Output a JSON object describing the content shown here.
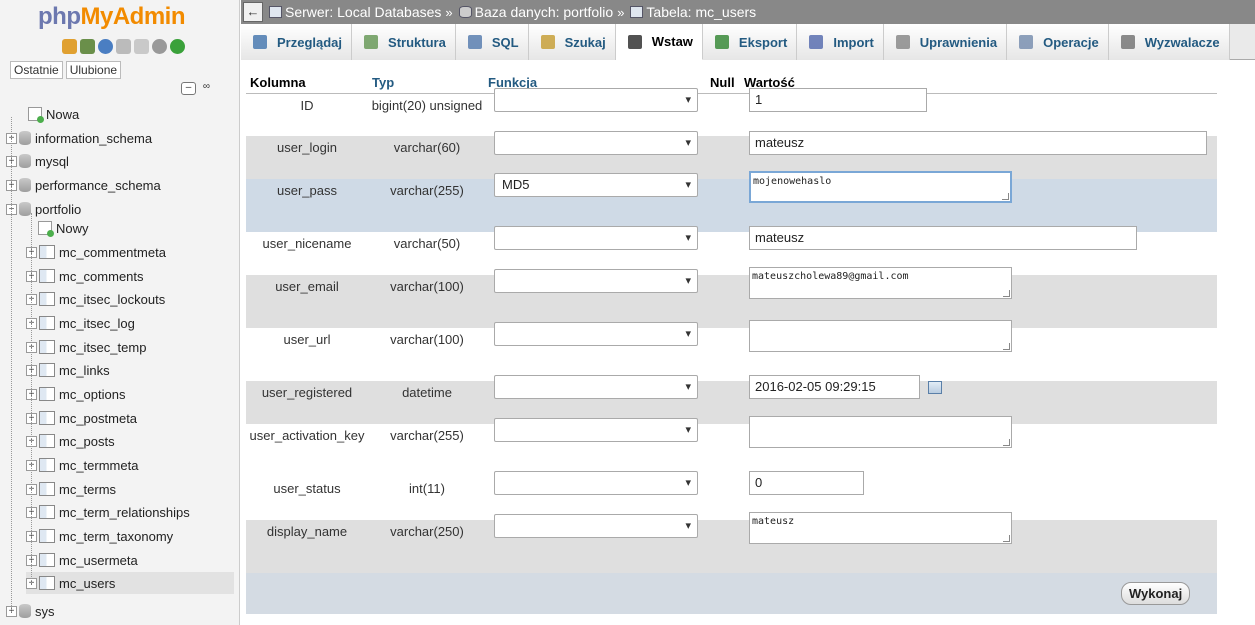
{
  "logo": {
    "part1": "php",
    "part2": "MyAdmin"
  },
  "sidebar": {
    "recent_tabs": [
      "Ostatnie",
      "Ulubione"
    ],
    "tree": [
      {
        "label": "Nowa",
        "kind": "new"
      },
      {
        "label": "information_schema",
        "kind": "db"
      },
      {
        "label": "mysql",
        "kind": "db"
      },
      {
        "label": "performance_schema",
        "kind": "db"
      },
      {
        "label": "portfolio",
        "kind": "db-open"
      },
      {
        "label": "Nowy",
        "kind": "new-table"
      },
      {
        "label": "mc_commentmeta",
        "kind": "table"
      },
      {
        "label": "mc_comments",
        "kind": "table"
      },
      {
        "label": "mc_itsec_lockouts",
        "kind": "table"
      },
      {
        "label": "mc_itsec_log",
        "kind": "table"
      },
      {
        "label": "mc_itsec_temp",
        "kind": "table"
      },
      {
        "label": "mc_links",
        "kind": "table"
      },
      {
        "label": "mc_options",
        "kind": "table"
      },
      {
        "label": "mc_postmeta",
        "kind": "table"
      },
      {
        "label": "mc_posts",
        "kind": "table"
      },
      {
        "label": "mc_termmeta",
        "kind": "table"
      },
      {
        "label": "mc_terms",
        "kind": "table"
      },
      {
        "label": "mc_term_relationships",
        "kind": "table"
      },
      {
        "label": "mc_term_taxonomy",
        "kind": "table"
      },
      {
        "label": "mc_usermeta",
        "kind": "table"
      },
      {
        "label": "mc_users",
        "kind": "table-selected"
      },
      {
        "label": "sys",
        "kind": "db"
      }
    ]
  },
  "breadcrumb": {
    "server": "Serwer: Local Databases",
    "database": "Baza danych: portfolio",
    "table": "Tabela: mc_users",
    "sep": "»"
  },
  "tabs": [
    {
      "label": "Przeglądaj",
      "icon": "browse-icon"
    },
    {
      "label": "Struktura",
      "icon": "structure-icon"
    },
    {
      "label": "SQL",
      "icon": "sql-icon"
    },
    {
      "label": "Szukaj",
      "icon": "search-icon"
    },
    {
      "label": "Wstaw",
      "icon": "insert-icon",
      "active": true
    },
    {
      "label": "Eksport",
      "icon": "export-icon"
    },
    {
      "label": "Import",
      "icon": "import-icon"
    },
    {
      "label": "Uprawnienia",
      "icon": "privileges-icon"
    },
    {
      "label": "Operacje",
      "icon": "wrench-icon"
    },
    {
      "label": "Wyzwalacze",
      "icon": "triggers-icon"
    }
  ],
  "form": {
    "headers": {
      "column": "Kolumna",
      "type": "Typ",
      "function": "Funkcja",
      "null": "Null",
      "value": "Wartość"
    },
    "rows": [
      {
        "column": "ID",
        "type": "bigint(20) unsigned",
        "function": "",
        "value": "1",
        "widget": "input"
      },
      {
        "column": "user_login",
        "type": "varchar(60)",
        "function": "",
        "value": "mateusz",
        "widget": "input"
      },
      {
        "column": "user_pass",
        "type": "varchar(255)",
        "function": "MD5",
        "value": "mojenowehaslo",
        "widget": "textarea"
      },
      {
        "column": "user_nicename",
        "type": "varchar(50)",
        "function": "",
        "value": "mateusz",
        "widget": "input"
      },
      {
        "column": "user_email",
        "type": "varchar(100)",
        "function": "",
        "value": "mateuszcholewa89@gmail.com",
        "widget": "textarea"
      },
      {
        "column": "user_url",
        "type": "varchar(100)",
        "function": "",
        "value": "",
        "widget": "textarea"
      },
      {
        "column": "user_registered",
        "type": "datetime",
        "function": "",
        "value": "2016-02-05 09:29:15",
        "widget": "input-date"
      },
      {
        "column": "user_activation_key",
        "type": "varchar(255)",
        "function": "",
        "value": "",
        "widget": "textarea"
      },
      {
        "column": "user_status",
        "type": "int(11)",
        "function": "",
        "value": "0",
        "widget": "input"
      },
      {
        "column": "display_name",
        "type": "varchar(250)",
        "function": "",
        "value": "mateusz",
        "widget": "textarea"
      }
    ],
    "submit_label": "Wykonaj"
  },
  "colors": {
    "link": "#235a81",
    "accent_orange": "#f28b00",
    "logo_blue": "#6c78af",
    "row_highlight": "#cfdae6"
  }
}
